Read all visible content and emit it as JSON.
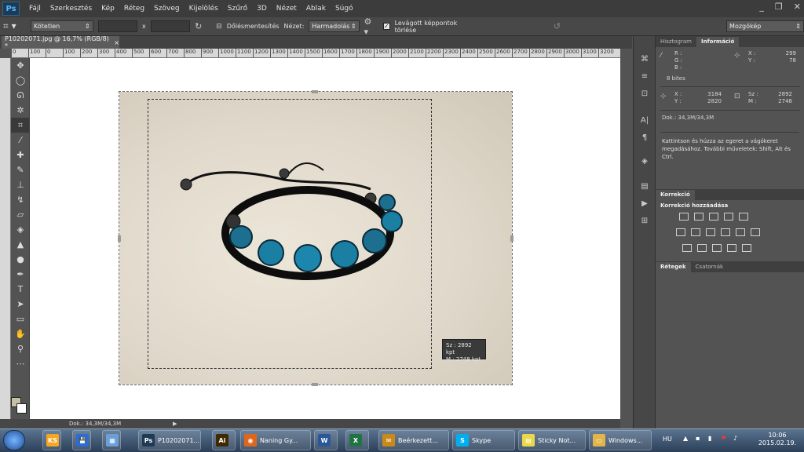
{
  "app": {
    "logo": "Ps"
  },
  "menu": [
    "Fájl",
    "Szerkesztés",
    "Kép",
    "Réteg",
    "Szöveg",
    "Kijelölés",
    "Szűrő",
    "3D",
    "Nézet",
    "Ablak",
    "Súgó"
  ],
  "window_controls": {
    "minimize": "_",
    "restore": "❐",
    "close": "✕"
  },
  "options": {
    "ratio_select": "Kötetlen",
    "swap_x": "x",
    "straighten_label": "Dőlésmentesítés",
    "view_label": "Nézet:",
    "view_select": "Harmadolás",
    "delete_pixels_label": "Levágott képpontok törlése",
    "workspace_select": "Mozgókép"
  },
  "document": {
    "tab_title": "P10202071.jpg @ 16,7% (RGB/8) *",
    "close": "×"
  },
  "ruler_ticks": [
    "0",
    "100",
    "0",
    "100",
    "200",
    "300",
    "400",
    "500",
    "600",
    "700",
    "800",
    "900",
    "1000",
    "1100",
    "1200",
    "1300",
    "1400",
    "1500",
    "1600",
    "1700",
    "1800",
    "1900",
    "2000",
    "2100",
    "2200",
    "2300",
    "2400",
    "2500",
    "2600",
    "2700",
    "2800",
    "2900",
    "3000",
    "3100",
    "3200"
  ],
  "crop_tooltip": {
    "w_label": "Sz :",
    "w_value": "2892 kpt",
    "h_label": "M :",
    "h_value": "2748 kpt"
  },
  "statusbar": {
    "doc": "Dok.: 34,3M/34,3M"
  },
  "panels": {
    "info_tabs": [
      "Hisztogram",
      "Információ"
    ],
    "info": {
      "r": "R :",
      "g": "G :",
      "b": "B :",
      "bits": "8 bites",
      "x_label": "X :",
      "x_value": "299",
      "y_label": "Y :",
      "y_value": "78",
      "x2_label": "X :",
      "x2_value": "3184",
      "y2_label": "Y :",
      "y2_value": "2820",
      "w_label": "Sz :",
      "w_value": "2892",
      "h_label": "M :",
      "h_value": "2748",
      "doc": "Dok.: 34,3M/34,3M",
      "hint": "Kattintson és húzza az egeret a vágókeret megadásához. További műveletek: Shift, Alt és Ctrl."
    },
    "correction_tab": "Korrekció",
    "correction_add": "Korrekció hozzáadása",
    "layers_tabs": [
      "Rétegek",
      "Csatornák"
    ]
  },
  "taskbar": {
    "items": [
      {
        "label": "",
        "icon": "KS",
        "color": "#f5a623"
      },
      {
        "label": "",
        "icon": "💾",
        "color": "#2a6dd6"
      },
      {
        "label": "",
        "icon": "▦",
        "color": "#6a9fd8"
      },
      {
        "label": "P10202071...",
        "icon": "Ps",
        "color": "#1f3a54"
      },
      {
        "label": "",
        "icon": "Ai",
        "color": "#3d2a00"
      },
      {
        "label": "Naning Gy...",
        "icon": "◉",
        "color": "#e0661b"
      },
      {
        "label": "",
        "icon": "W",
        "color": "#2b579a"
      },
      {
        "label": "",
        "icon": "X",
        "color": "#217346"
      },
      {
        "label": "Beérkezett...",
        "icon": "✉",
        "color": "#c98a1a"
      },
      {
        "label": "Skype",
        "icon": "S",
        "color": "#00aff0"
      },
      {
        "label": "Sticky Not...",
        "icon": "▤",
        "color": "#e8d84a"
      },
      {
        "label": "Windows...",
        "icon": "▭",
        "color": "#e2b54a"
      }
    ],
    "lang": "HU",
    "time": "10:06",
    "date": "2015.02.19."
  }
}
